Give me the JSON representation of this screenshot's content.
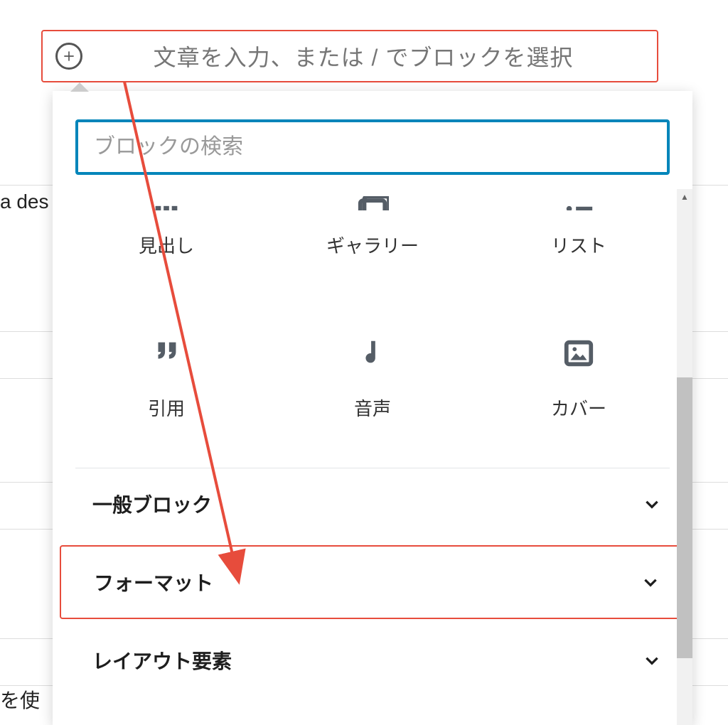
{
  "top": {
    "placeholder": "文章を入力、または / でブロックを選択"
  },
  "search": {
    "placeholder": "ブロックの検索"
  },
  "blocks": {
    "row1": [
      {
        "label": "見出し"
      },
      {
        "label": "ギャラリー"
      },
      {
        "label": "リスト"
      }
    ],
    "row2": [
      {
        "label": "引用"
      },
      {
        "label": "音声"
      },
      {
        "label": "カバー"
      }
    ]
  },
  "categories": {
    "general": "一般ブロック",
    "format": "フォーマット",
    "layout": "レイアウト要素"
  },
  "bg": {
    "text1": "a des",
    "text2": "を使"
  }
}
